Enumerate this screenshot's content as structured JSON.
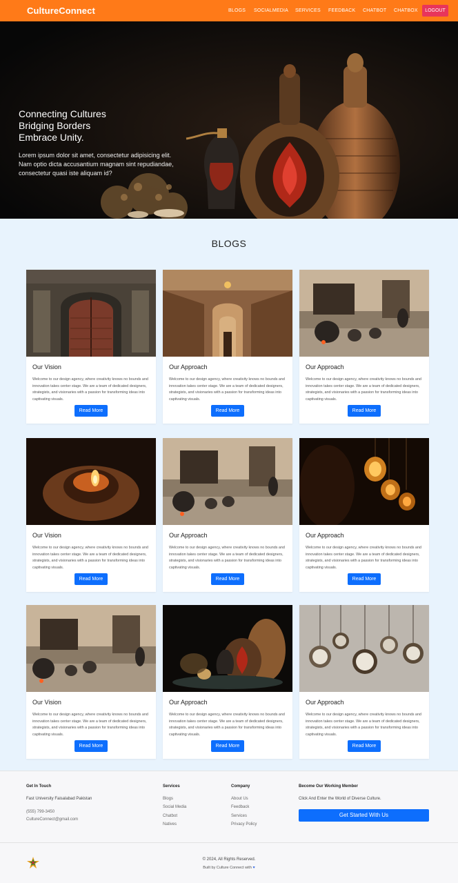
{
  "navbar": {
    "brand": "CultureConnect",
    "items": [
      "BLOGS",
      "SOCIALMEDIA",
      "SERVICES",
      "FEEDBACK",
      "CHATBOT",
      "CHATBOX"
    ],
    "logout_label": "LOGOUT",
    "bg_color": "#ff7a18",
    "logout_color": "#e8355b"
  },
  "hero": {
    "title_lines": [
      "Connecting Cultures",
      "Bridging Borders",
      "Embrace Unity."
    ],
    "body": "Lorem ipsum dolor sit amet, consectetur adipisicing elit. Nam optio dicta accusantium magnam sint repudiandae, consectetur quasi iste aliquam id?",
    "image": "ornate-vases-photo"
  },
  "blogs": {
    "title": "BLOGS",
    "read_more_label": "Read More",
    "card_text": "Welcome to our design agency, where creativity knows no bounds and innovation takes center stage. We are a team of dedicated designers, strategists, and visionaries with a passion for transforming ideas into captivating visuals.",
    "cards": [
      {
        "title": "Our Vision",
        "image": "carved-doorway-photo"
      },
      {
        "title": "Our Approach",
        "image": "ornate-hallway-photo"
      },
      {
        "title": "Our Approach",
        "image": "clay-kitchen-photo"
      },
      {
        "title": "Our Vision",
        "image": "oil-lamp-hands-photo"
      },
      {
        "title": "Our Approach",
        "image": "clay-kitchen-photo"
      },
      {
        "title": "Our Approach",
        "image": "hanging-lanterns-photo"
      },
      {
        "title": "Our Vision",
        "image": "clay-kitchen-photo"
      },
      {
        "title": "Our Approach",
        "image": "ornate-vases-photo"
      },
      {
        "title": "Our Approach",
        "image": "pocket-watches-photo"
      }
    ]
  },
  "footer": {
    "contact": {
      "heading": "Get In Touch",
      "address": "Fast University Faisalabad Pakistan",
      "phone": "(555) 799-3450",
      "email": "CultureConnect@gmail.com"
    },
    "services": {
      "heading": "Services",
      "links": [
        "Blogs",
        "Social Media",
        "Chatbot",
        "Natives"
      ]
    },
    "company": {
      "heading": "Company",
      "links": [
        "About Us",
        "Feedback",
        "Services",
        "Privacy Policy"
      ]
    },
    "member": {
      "heading": "Become Our Working Member",
      "text": "Click And Enter the World of Diverse Culture.",
      "button_label": "Get Started With Us"
    },
    "copyright": "© 2024, All Rights Reserved.",
    "built_by": "Built by Culture Connect with",
    "heart": "♥"
  }
}
